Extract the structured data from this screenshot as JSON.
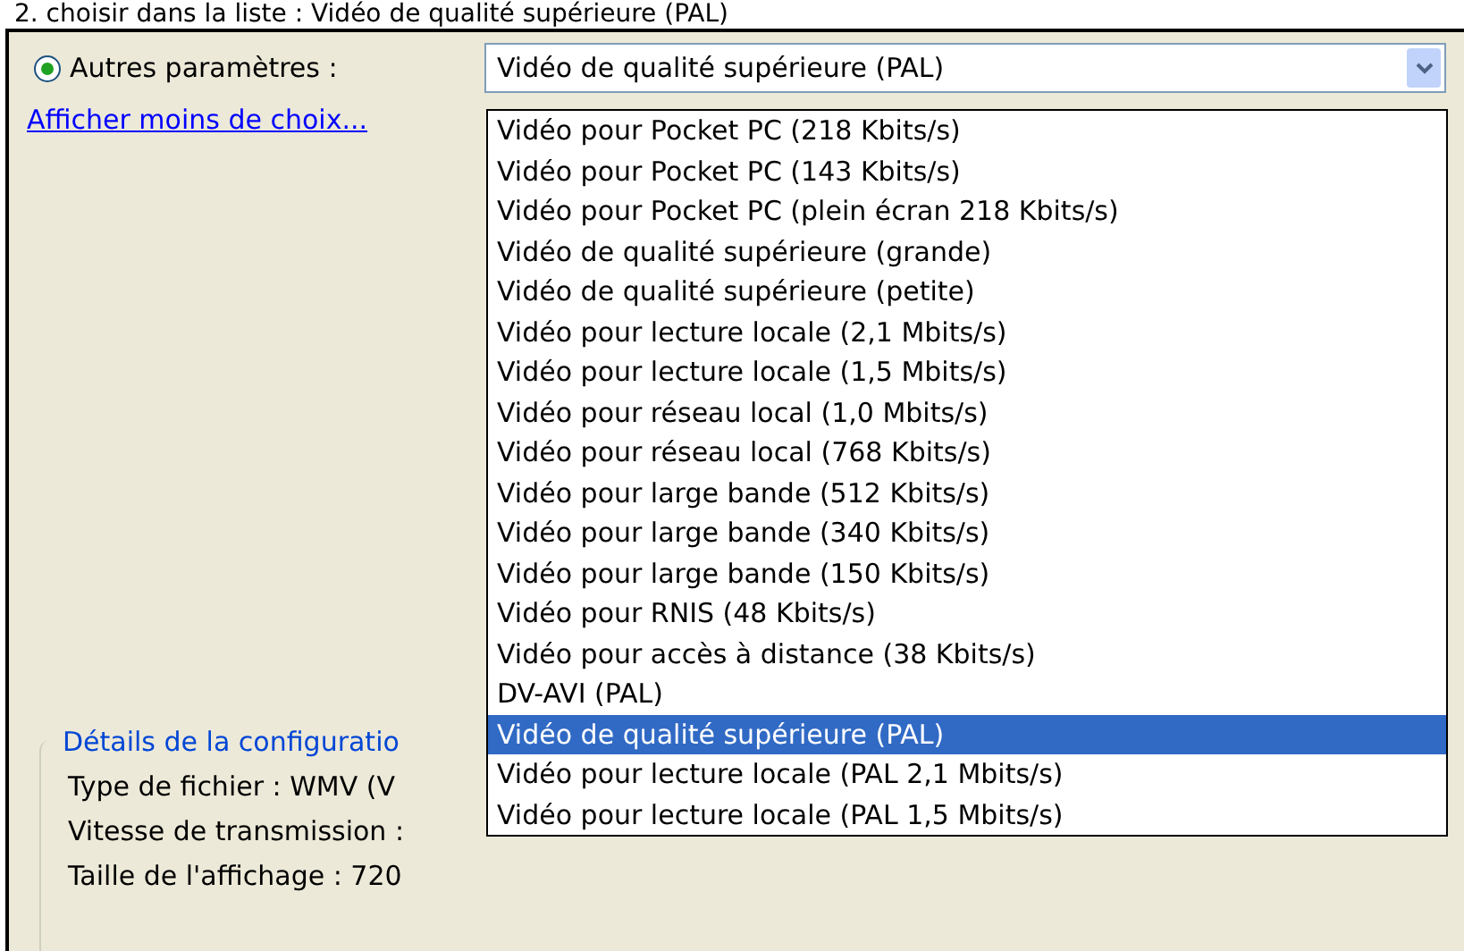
{
  "caption": "2. choisir dans la liste : Vidéo de qualité supérieure (PAL)",
  "option": {
    "label": "Autres paramètres :",
    "selected": true
  },
  "combo": {
    "value": "Vidéo de qualité supérieure (PAL)",
    "options": [
      {
        "label": "Vidéo pour Pocket PC (218 Kbits/s)",
        "selected": false
      },
      {
        "label": "Vidéo pour Pocket PC (143 Kbits/s)",
        "selected": false
      },
      {
        "label": "Vidéo pour Pocket PC (plein écran 218 Kbits/s)",
        "selected": false
      },
      {
        "label": "Vidéo de qualité supérieure (grande)",
        "selected": false
      },
      {
        "label": "Vidéo de qualité supérieure (petite)",
        "selected": false
      },
      {
        "label": "Vidéo pour lecture locale (2,1 Mbits/s)",
        "selected": false
      },
      {
        "label": "Vidéo pour lecture locale (1,5 Mbits/s)",
        "selected": false
      },
      {
        "label": "Vidéo pour réseau local (1,0 Mbits/s)",
        "selected": false
      },
      {
        "label": "Vidéo pour réseau local (768 Kbits/s)",
        "selected": false
      },
      {
        "label": "Vidéo pour large bande (512 Kbits/s)",
        "selected": false
      },
      {
        "label": "Vidéo pour large bande (340 Kbits/s)",
        "selected": false
      },
      {
        "label": "Vidéo pour large bande (150 Kbits/s)",
        "selected": false
      },
      {
        "label": "Vidéo pour RNIS (48 Kbits/s)",
        "selected": false
      },
      {
        "label": "Vidéo pour accès à distance (38 Kbits/s)",
        "selected": false
      },
      {
        "label": "DV-AVI (PAL)",
        "selected": false
      },
      {
        "label": "Vidéo de qualité supérieure (PAL)",
        "selected": true
      },
      {
        "label": "Vidéo pour lecture locale (PAL 2,1 Mbits/s)",
        "selected": false
      },
      {
        "label": "Vidéo pour lecture locale (PAL 1,5 Mbits/s)",
        "selected": false
      }
    ]
  },
  "link": "Afficher moins de choix...",
  "details": {
    "title": "Détails de la configuratio",
    "lines": [
      {
        "text": "Type de fichier : WMV (V"
      },
      {
        "text": "Vitesse de transmission :"
      },
      {
        "text": "Taille de l'affichage : 720"
      }
    ]
  }
}
